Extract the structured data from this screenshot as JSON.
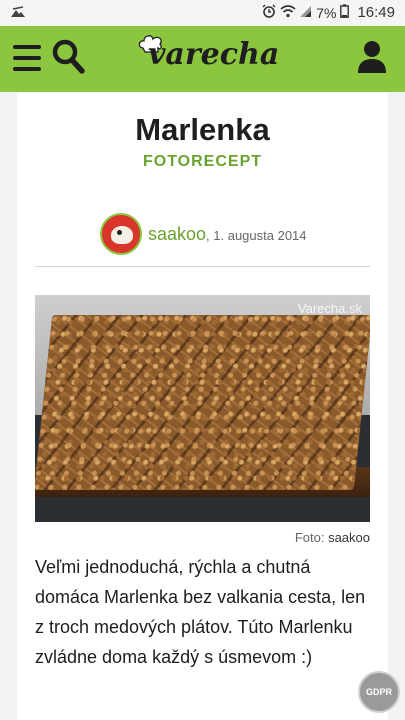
{
  "status_bar": {
    "left_icon": "mountain-notification-icon",
    "icons": [
      "alarm-icon",
      "wifi-icon",
      "signal-icon"
    ],
    "battery": "7%",
    "time": "16:49"
  },
  "header": {
    "menu_icon": "hamburger-menu-icon",
    "search_icon": "search-icon",
    "logo_text": "varecha",
    "user_icon": "user-icon",
    "background_color": "#8cc63f"
  },
  "recipe": {
    "title": "Marlenka",
    "subtitle": "FOTORECEPT",
    "author": "saakoo",
    "date": ", 1. augusta 2014",
    "photo_watermark": "Varecha.sk",
    "photo_caption_prefix": "Foto:",
    "photo_caption_author": "saakoo",
    "description": "Veľmi jednoduchá, rýchla a chutná domáca Marlenka bez valkania cesta, len z troch medových plátov. Túto Marlenku zvládne doma každý s úsmevom :)"
  },
  "gdpr_badge": "GDPR",
  "colors": {
    "accent": "#6aa32f",
    "text": "#1e1e1e"
  }
}
